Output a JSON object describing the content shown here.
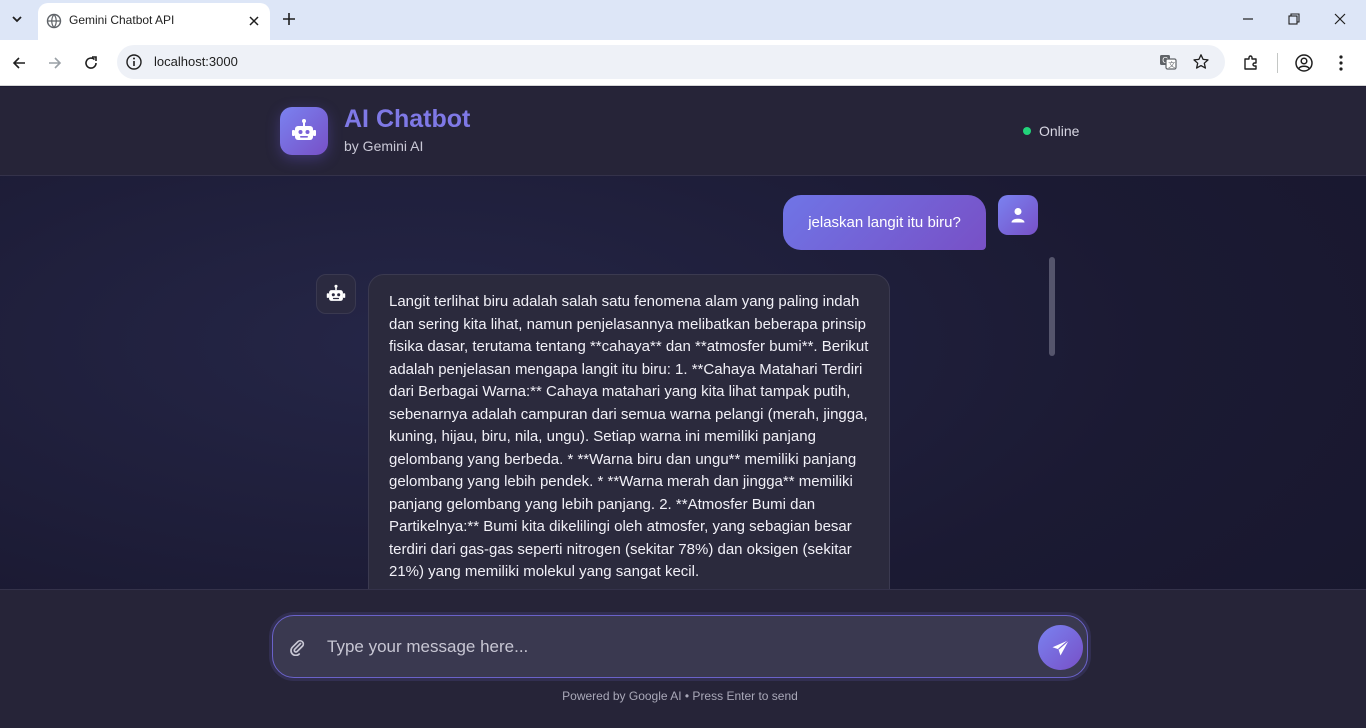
{
  "browser": {
    "tab_title": "Gemini Chatbot API",
    "url": "localhost:3000",
    "icons": [
      "tab-search-icon",
      "globe-icon",
      "close-icon",
      "plus-icon",
      "minimize-icon",
      "restore-icon",
      "back-icon",
      "forward-icon",
      "reload-icon",
      "info-icon",
      "translate-icon",
      "star-icon",
      "extensions-icon",
      "profile-icon",
      "menu-icon"
    ]
  },
  "header": {
    "title": "AI Chatbot",
    "subtitle": "by Gemini AI",
    "status": "Online",
    "status_color": "#22d37a",
    "accent": "#7a6fe6"
  },
  "messages": {
    "user": "jelaskan langit itu biru?",
    "bot": "Langit terlihat biru adalah salah satu fenomena alam yang paling indah dan sering kita lihat, namun penjelasannya melibatkan beberapa prinsip fisika dasar, terutama tentang **cahaya** dan **atmosfer bumi**. Berikut adalah penjelasan mengapa langit itu biru: 1. **Cahaya Matahari Terdiri dari Berbagai Warna:** Cahaya matahari yang kita lihat tampak putih, sebenarnya adalah campuran dari semua warna pelangi (merah, jingga, kuning, hijau, biru, nila, ungu). Setiap warna ini memiliki panjang gelombang yang berbeda. * **Warna biru dan ungu** memiliki panjang gelombang yang lebih pendek. * **Warna merah dan jingga** memiliki panjang gelombang yang lebih panjang. 2. **Atmosfer Bumi dan Partikelnya:** Bumi kita dikelilingi oleh atmosfer, yang sebagian besar terdiri dari gas-gas seperti nitrogen (sekitar 78%) dan oksigen (sekitar 21%) yang memiliki molekul yang sangat kecil."
  },
  "composer": {
    "placeholder": "Type your message here...",
    "footer_note": "Powered by Google AI • Press Enter to send"
  }
}
